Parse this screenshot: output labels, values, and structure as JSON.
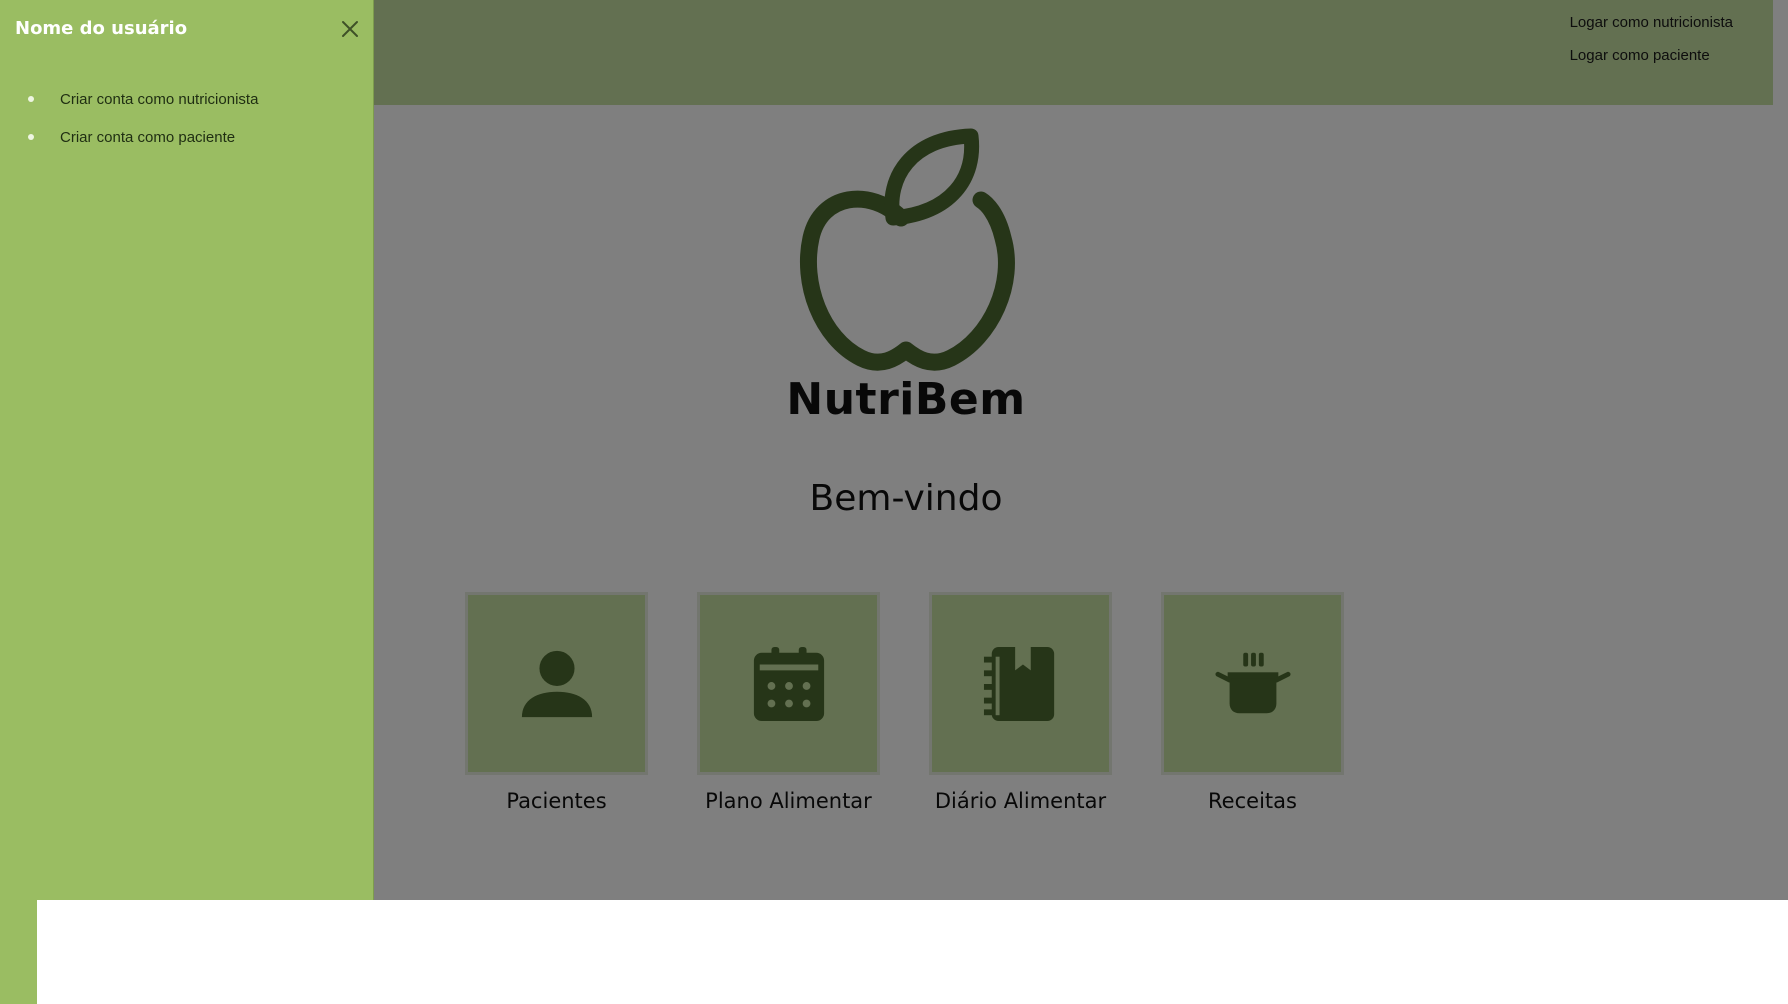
{
  "colors": {
    "drawer_bg": "#9abd62",
    "topbar_bg": "#c7e0a3",
    "card_bg": "#c7e0a3",
    "icon_color": "#4d6a31",
    "overlay": "rgba(0,0,0,0.5)"
  },
  "drawer": {
    "title": "Nome do usuário",
    "close_icon": "close-icon",
    "items": [
      {
        "label": "Criar conta como nutricionista"
      },
      {
        "label": "Criar conta como paciente"
      }
    ]
  },
  "header": {
    "links": [
      {
        "label": "Logar como nutricionista"
      },
      {
        "label": "Logar como paciente"
      }
    ]
  },
  "main": {
    "logo_icon": "apple-icon",
    "brand": "NutriBem",
    "welcome": "Bem-vindo",
    "cards": [
      {
        "label": "Pacientes",
        "icon": "person-icon"
      },
      {
        "label": "Plano Alimentar",
        "icon": "calendar-icon"
      },
      {
        "label": "Diário Alimentar",
        "icon": "notebook-icon"
      },
      {
        "label": "Receitas",
        "icon": "cooking-pot-icon"
      }
    ]
  }
}
